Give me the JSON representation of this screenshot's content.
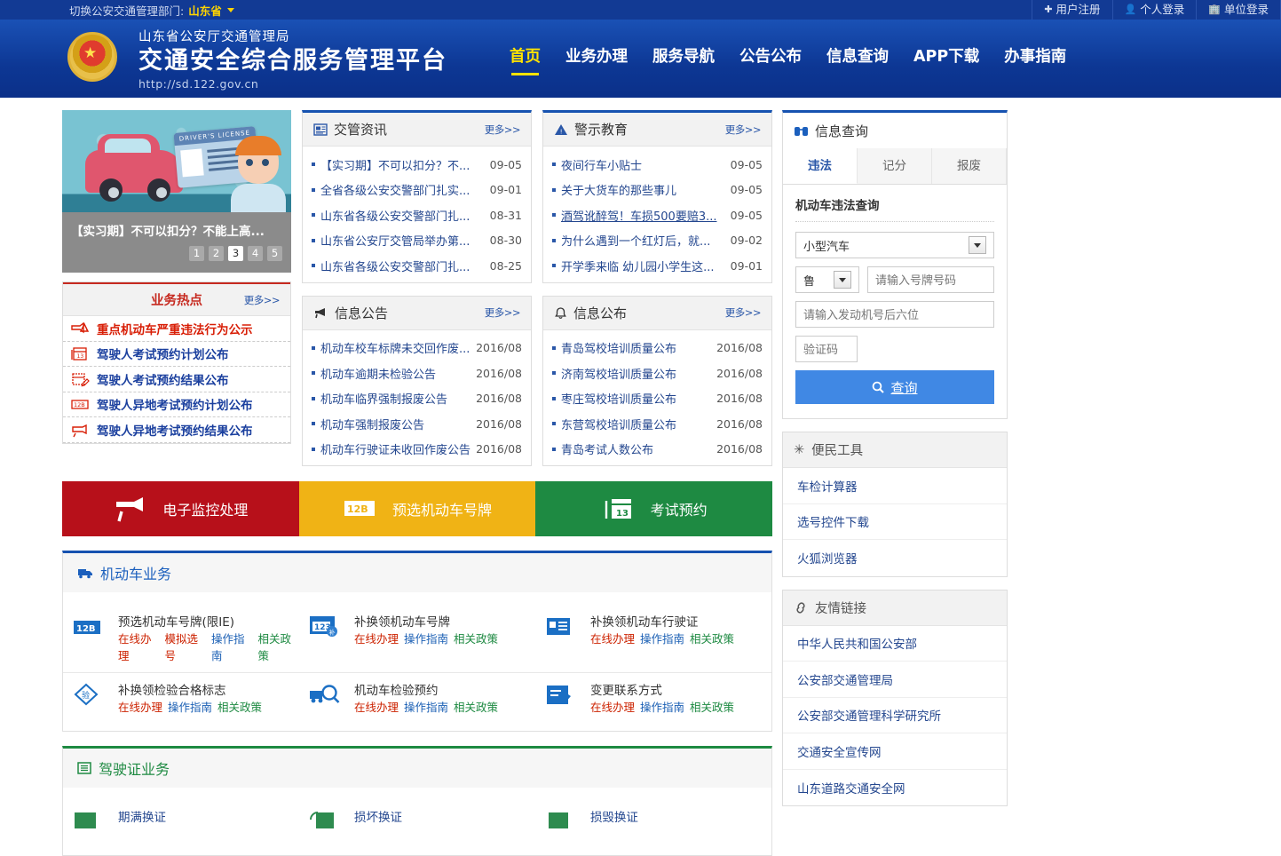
{
  "topbar": {
    "switch_label": "切换公安交通管理部门:",
    "region": "山东省",
    "auth": [
      {
        "icon": "plus-icon",
        "label": "用户注册"
      },
      {
        "icon": "person-icon",
        "label": "个人登录"
      },
      {
        "icon": "building-icon",
        "label": "单位登录"
      }
    ]
  },
  "header": {
    "org": "山东省公安厅交通管理局",
    "title": "交通安全综合服务管理平台",
    "url": "http://sd.122.gov.cn",
    "nav": [
      {
        "label": "首页",
        "active": true
      },
      {
        "label": "业务办理",
        "active": false
      },
      {
        "label": "服务导航",
        "active": false
      },
      {
        "label": "公告公布",
        "active": false
      },
      {
        "label": "信息查询",
        "active": false
      },
      {
        "label": "APP下载",
        "active": false
      },
      {
        "label": "办事指南",
        "active": false
      }
    ]
  },
  "banner": {
    "image_alt": "driver-license-illustration",
    "license_text": "DRIVER'S LICENSE",
    "caption": "【实习期】不可以扣分？不能上高...",
    "dots": [
      "1",
      "2",
      "3",
      "4",
      "5"
    ],
    "active_dot": "3"
  },
  "hot": {
    "title": "业务热点",
    "more": "更多>>",
    "items": [
      {
        "icon": "violation-warning-icon",
        "label": "重点机动车严重违法行为公示",
        "highlight": true
      },
      {
        "icon": "calendar-13-icon",
        "label": "驾驶人考试预约计划公布",
        "highlight": false
      },
      {
        "icon": "calendar-pen-icon",
        "label": "驾驶人考试预约结果公布",
        "highlight": false
      },
      {
        "icon": "plate-123-icon",
        "label": "驾驶人异地考试预约计划公布",
        "highlight": false
      },
      {
        "icon": "camera-icon",
        "label": "驾驶人异地考试预约结果公布",
        "highlight": false
      }
    ]
  },
  "news_panels": [
    {
      "icon": "news-icon",
      "title": "交管资讯",
      "more": "更多>>",
      "items": [
        {
          "title": "【实习期】不可以扣分？不...",
          "date": "09-05",
          "visited": false
        },
        {
          "title": "全省各级公安交警部门扎实...",
          "date": "09-01",
          "visited": false
        },
        {
          "title": "山东省各级公安交警部门扎...",
          "date": "08-31",
          "visited": false
        },
        {
          "title": "山东省公安厅交管局举办第...",
          "date": "08-30",
          "visited": false
        },
        {
          "title": "山东省各级公安交警部门扎...",
          "date": "08-25",
          "visited": false
        }
      ]
    },
    {
      "icon": "warning-triangle-icon",
      "title": "警示教育",
      "more": "更多>>",
      "items": [
        {
          "title": "夜间行车小贴士",
          "date": "09-05",
          "visited": false
        },
        {
          "title": "关于大货车的那些事儿",
          "date": "09-05",
          "visited": false
        },
        {
          "title": "酒驾讹醉驾！车损500要赔3...",
          "date": "09-05",
          "visited": true
        },
        {
          "title": "为什么遇到一个红灯后，就...",
          "date": "09-02",
          "visited": false
        },
        {
          "title": "开学季来临 幼儿园小学生这...",
          "date": "09-01",
          "visited": false
        }
      ]
    },
    {
      "icon": "megaphone-icon",
      "title": "信息公告",
      "more": "更多>>",
      "items": [
        {
          "title": "机动车校车标牌未交回作废...",
          "date": "2016/08",
          "visited": false
        },
        {
          "title": "机动车逾期未检验公告",
          "date": "2016/08",
          "visited": false
        },
        {
          "title": "机动车临界强制报废公告",
          "date": "2016/08",
          "visited": false
        },
        {
          "title": "机动车强制报废公告",
          "date": "2016/08",
          "visited": false
        },
        {
          "title": "机动车行驶证未收回作废公告",
          "date": "2016/08",
          "visited": false
        }
      ]
    },
    {
      "icon": "bell-icon",
      "title": "信息公布",
      "more": "更多>>",
      "items": [
        {
          "title": "青岛驾校培训质量公布",
          "date": "2016/08",
          "visited": false
        },
        {
          "title": "济南驾校培训质量公布",
          "date": "2016/08",
          "visited": false
        },
        {
          "title": "枣庄驾校培训质量公布",
          "date": "2016/08",
          "visited": false
        },
        {
          "title": "东营驾校培训质量公布",
          "date": "2016/08",
          "visited": false
        },
        {
          "title": "青岛考试人数公布",
          "date": "2016/08",
          "visited": false
        }
      ]
    }
  ],
  "actions": [
    {
      "icon": "surveillance-camera-icon",
      "label": "电子监控处理",
      "color": "#b7101a"
    },
    {
      "icon": "plate-number-icon",
      "label": "预选机动车号牌",
      "color": "#f0b315"
    },
    {
      "icon": "exam-calendar-icon",
      "label": "考试预约",
      "color": "#1e8a42"
    }
  ],
  "sections": [
    {
      "icon": "truck-icon",
      "title": "机动车业务",
      "services": [
        {
          "icon": "plate-select-icon",
          "name": "预选机动车号牌(限IE)",
          "links": [
            {
              "t": "在线办理",
              "c": "r"
            },
            {
              "t": "模拟选号",
              "c": "r"
            },
            {
              "t": "操作指南",
              "c": "b"
            },
            {
              "t": "相关政策",
              "c": "g"
            }
          ]
        },
        {
          "icon": "plate-replace-icon",
          "name": "补换领机动车号牌",
          "links": [
            {
              "t": "在线办理",
              "c": "r"
            },
            {
              "t": "操作指南",
              "c": "b"
            },
            {
              "t": "相关政策",
              "c": "g"
            }
          ]
        },
        {
          "icon": "license-card-icon",
          "name": "补换领机动车行驶证",
          "links": [
            {
              "t": "在线办理",
              "c": "r"
            },
            {
              "t": "操作指南",
              "c": "b"
            },
            {
              "t": "相关政策",
              "c": "g"
            }
          ]
        },
        {
          "icon": "inspection-badge-icon",
          "name": "补换领检验合格标志",
          "links": [
            {
              "t": "在线办理",
              "c": "r"
            },
            {
              "t": "操作指南",
              "c": "b"
            },
            {
              "t": "相关政策",
              "c": "g"
            }
          ]
        },
        {
          "icon": "vehicle-inspect-icon",
          "name": "机动车检验预约",
          "links": [
            {
              "t": "在线办理",
              "c": "r"
            },
            {
              "t": "操作指南",
              "c": "b"
            },
            {
              "t": "相关政策",
              "c": "g"
            }
          ]
        },
        {
          "icon": "edit-contact-icon",
          "name": "变更联系方式",
          "links": [
            {
              "t": "在线办理",
              "c": "r"
            },
            {
              "t": "操作指南",
              "c": "b"
            },
            {
              "t": "相关政策",
              "c": "g"
            }
          ]
        }
      ]
    },
    {
      "icon": "document-icon",
      "title": "驾驶证业务",
      "services": [
        {
          "icon": "renew-license-icon",
          "name": "期满换证",
          "links": []
        },
        {
          "icon": "replace-license-icon",
          "name": "损坏换证",
          "links": []
        },
        {
          "icon": "lost-license-icon",
          "name": "损毁换证",
          "links": []
        }
      ]
    }
  ],
  "query": {
    "panel_icon": "binoculars-icon",
    "panel_title": "信息查询",
    "tabs": [
      {
        "label": "违法",
        "active": true
      },
      {
        "label": "记分",
        "active": false
      },
      {
        "label": "报废",
        "active": false
      }
    ],
    "form_title": "机动车违法查询",
    "vehicle_type": "小型汽车",
    "province": "鲁",
    "plate_placeholder": "请输入号牌号码",
    "engine_placeholder": "请输入发动机号后六位",
    "captcha_placeholder": "验证码",
    "submit_label": "查询",
    "submit_icon": "search-icon"
  },
  "tools": {
    "icon": "asterisk-icon",
    "title": "便民工具",
    "items": [
      "车检计算器",
      "选号控件下载",
      "火狐浏览器"
    ]
  },
  "links": {
    "icon": "link-icon",
    "title": "友情链接",
    "items": [
      "中华人民共和国公安部",
      "公安部交通管理局",
      "公安部交通管理科学研究所",
      "交通安全宣传网",
      "山东道路交通安全网"
    ]
  },
  "colors": {
    "header_blue": "#0d3794",
    "topbar_blue": "#123a94",
    "accent_yellow": "#ffe300",
    "link_blue": "#24478f",
    "hot_red": "#c62a20",
    "action_red": "#b7101a",
    "action_yellow": "#f0b315",
    "action_green": "#1e8a42",
    "button_blue": "#4088e4"
  }
}
